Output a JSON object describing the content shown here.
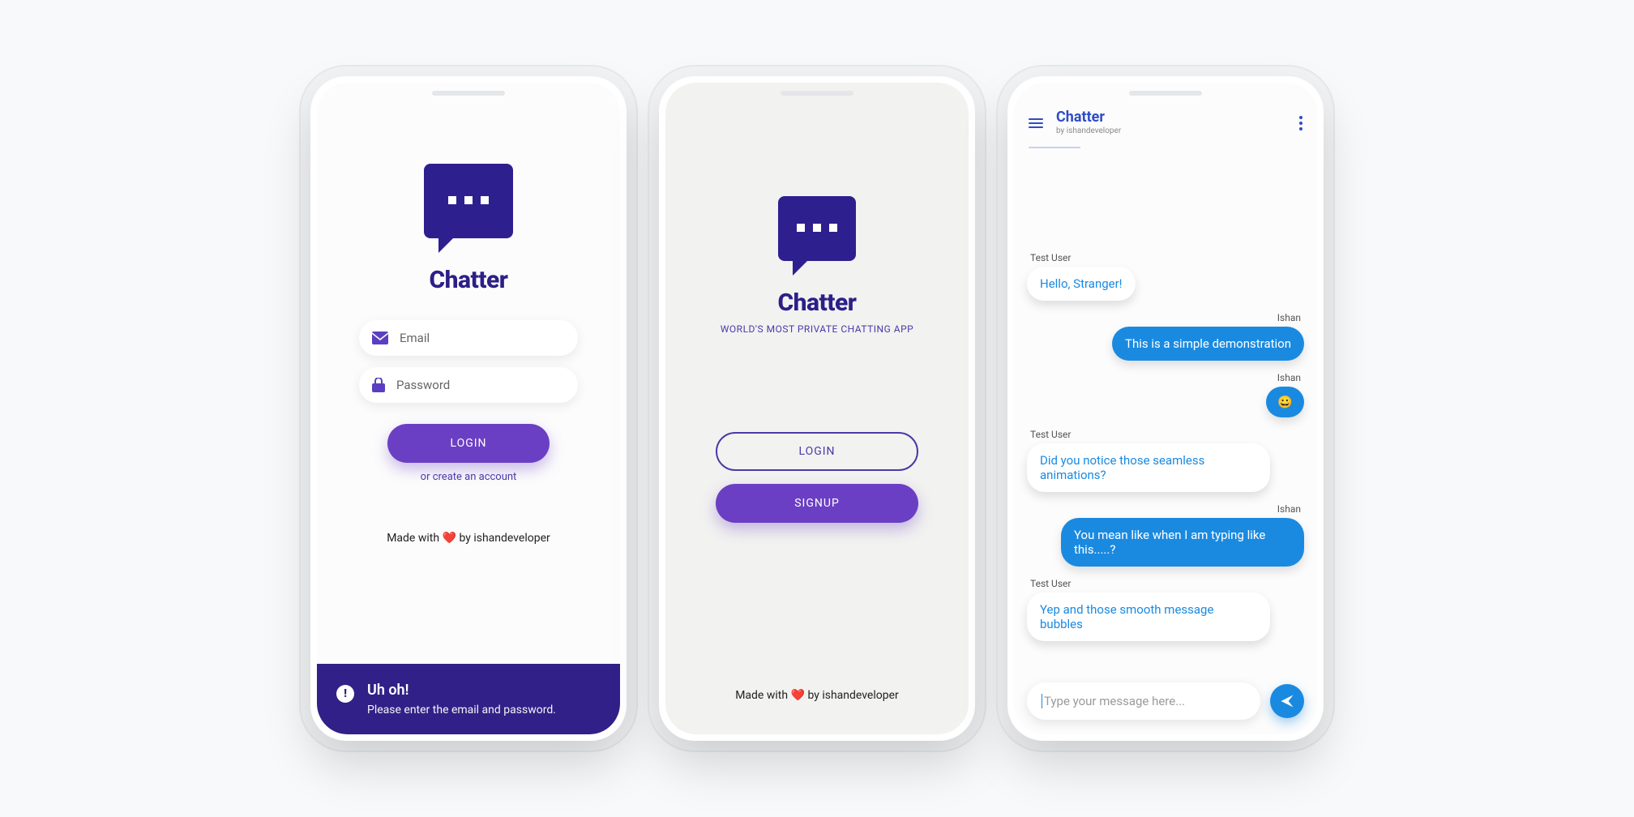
{
  "colors": {
    "primary": "#2e1f8f",
    "accent": "#6b3fc4",
    "blue": "#1a8ae1"
  },
  "login": {
    "brand": "Chatter",
    "email_placeholder": "Email",
    "password_placeholder": "Password",
    "login_label": "LOGIN",
    "create_account": "or create an account",
    "footer_pre": "Made with ",
    "footer_heart": "❤️",
    "footer_post": " by ishandeveloper",
    "error_title": "Uh oh!",
    "error_msg": "Please enter the email and password."
  },
  "landing": {
    "brand": "Chatter",
    "tagline": "WORLD'S MOST PRIVATE CHATTING APP",
    "login_label": "LOGIN",
    "signup_label": "SIGNUP",
    "footer_pre": "Made with ",
    "footer_heart": "❤️",
    "footer_post": " by ishandeveloper"
  },
  "chat": {
    "title": "Chatter",
    "subtitle": "by ishandeveloper",
    "composer_placeholder": "Type your message here...",
    "messages": [
      {
        "from": "Test User",
        "text": "Hello, Stranger!",
        "side": "left"
      },
      {
        "from": "Ishan",
        "text": "This is a simple demonstration",
        "side": "right"
      },
      {
        "from": "Ishan",
        "text": "😀",
        "side": "right",
        "emoji": true
      },
      {
        "from": "Test User",
        "text": "Did you notice those seamless animations?",
        "side": "left"
      },
      {
        "from": "Ishan",
        "text": "You mean like when I am typing like this.....?",
        "side": "right"
      },
      {
        "from": "Test User",
        "text": "Yep and those smooth message bubbles",
        "side": "left"
      }
    ]
  }
}
